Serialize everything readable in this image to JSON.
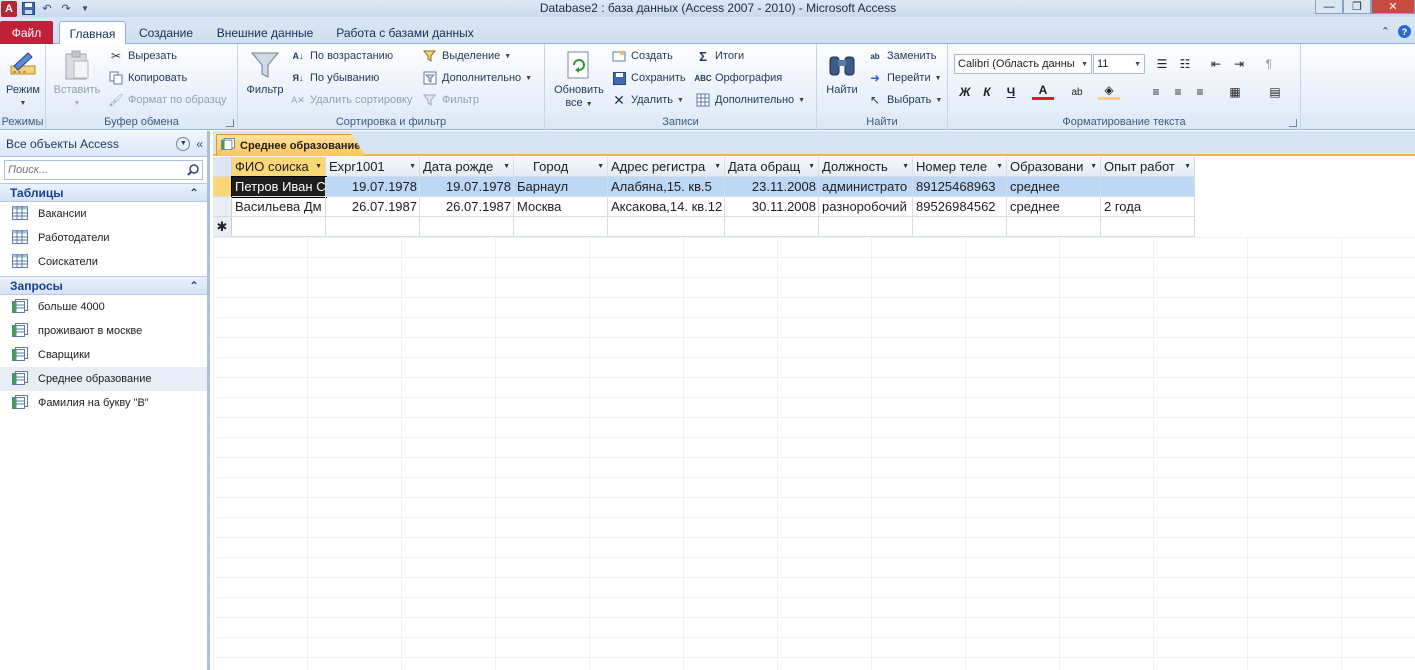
{
  "window": {
    "title": "Database2 : база данных (Access 2007 - 2010)  -  Microsoft Access",
    "app_icon_letter": "A"
  },
  "tabs": {
    "file": "Файл",
    "items": [
      "Главная",
      "Создание",
      "Внешние данные",
      "Работа с базами данных"
    ]
  },
  "ribbon": {
    "groups": {
      "views": {
        "label": "Режимы",
        "mode": "Режим"
      },
      "clipboard": {
        "label": "Буфер обмена",
        "paste": "Вставить",
        "cut": "Вырезать",
        "copy": "Копировать",
        "format_painter": "Формат по образцу"
      },
      "sort_filter": {
        "label": "Сортировка и фильтр",
        "filter": "Фильтр",
        "ascending": "По возрастанию",
        "descending": "По убыванию",
        "remove_sort": "Удалить сортировку",
        "selection": "Выделение",
        "advanced": "Дополнительно",
        "toggle_filter": "Фильтр"
      },
      "records": {
        "label": "Записи",
        "refresh": "Обновить",
        "refresh2": "все",
        "new": "Создать",
        "save": "Сохранить",
        "delete": "Удалить",
        "totals": "Итоги",
        "spelling": "Орфография",
        "more": "Дополнительно"
      },
      "find": {
        "label": "Найти",
        "find": "Найти",
        "replace": "Заменить",
        "goto": "Перейти",
        "select": "Выбрать"
      },
      "text_formatting": {
        "label": "Форматирование текста",
        "font": "Calibri (Область данны",
        "size": "11",
        "bold": "Ж",
        "italic": "К",
        "underline": "Ч"
      }
    }
  },
  "nav": {
    "title": "Все объекты Access",
    "search_placeholder": "Поиск...",
    "groups": [
      {
        "name": "Таблицы",
        "items": [
          "Вакансии",
          "Работодатели",
          "Соискатели"
        ]
      },
      {
        "name": "Запросы",
        "items": [
          "больше 4000",
          "проживают в москве",
          "Сварщики",
          "Среднее образование",
          "Фамилия на букву \"В\""
        ]
      }
    ]
  },
  "document": {
    "tab_title": "Среднее образование",
    "columns": [
      "ФИО соиска",
      "Expr1001",
      "Дата рожде",
      "Город",
      "Адрес регистра",
      "Дата обращ",
      "Должность",
      "Номер теле",
      "Образовани",
      "Опыт работ"
    ],
    "rows": [
      [
        "Петров Иван С",
        "19.07.1978",
        "19.07.1978",
        "Барнаул",
        "Алабяна,15. кв.5",
        "23.11.2008",
        "администрато",
        "89125468963",
        "среднее",
        ""
      ],
      [
        "Васильева Дм",
        "26.07.1987",
        "26.07.1987",
        "Москва",
        "Аксакова,14. кв.12",
        "30.11.2008",
        "разноробочий",
        "89526984562",
        "среднее",
        "2 года"
      ]
    ],
    "new_row_marker": "✱"
  }
}
